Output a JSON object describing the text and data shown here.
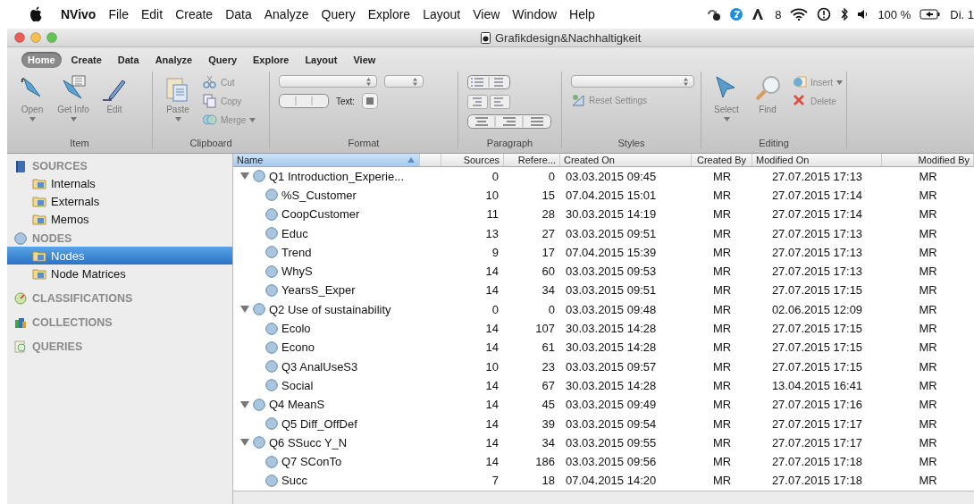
{
  "menu_bar": {
    "app": "NVivo",
    "items": [
      "File",
      "Edit",
      "Create",
      "Data",
      "Analyze",
      "Query",
      "Explore",
      "Layout",
      "View",
      "Window",
      "Help"
    ],
    "badge": "8",
    "battery": "100 %",
    "clock": "Di. 1"
  },
  "window": {
    "title": "Grafikdesign&Nachhaltigkeit"
  },
  "ribbon": {
    "tabs": [
      {
        "label": "Home",
        "selected": true
      },
      {
        "label": "Create",
        "selected": false
      },
      {
        "label": "Data",
        "selected": false
      },
      {
        "label": "Analyze",
        "selected": false
      },
      {
        "label": "Query",
        "selected": false
      },
      {
        "label": "Explore",
        "selected": false
      },
      {
        "label": "Layout",
        "selected": false
      },
      {
        "label": "View",
        "selected": false
      }
    ],
    "groups": [
      {
        "kind": "item",
        "label": "Item",
        "large": [
          {
            "label": "Open",
            "menu": true
          },
          {
            "label": "Get Info",
            "menu": true
          },
          {
            "label": "Edit",
            "menu": false
          }
        ]
      },
      {
        "kind": "clipboard",
        "label": "Clipboard",
        "large": [
          {
            "label": "Paste",
            "menu": true
          }
        ],
        "small": [
          {
            "label": "Cut",
            "menu": false
          },
          {
            "label": "Copy",
            "menu": false
          },
          {
            "label": "Merge",
            "menu": true
          }
        ]
      },
      {
        "kind": "format",
        "label": "Format",
        "text_label": "Text:"
      },
      {
        "kind": "paragraph",
        "label": "Paragraph"
      },
      {
        "kind": "styles",
        "label": "Styles",
        "small": [
          {
            "label": "Reset Settings",
            "menu": false
          }
        ]
      },
      {
        "kind": "editing",
        "label": "Editing",
        "large": [
          {
            "label": "Select",
            "menu": true
          },
          {
            "label": "Find",
            "menu": false
          }
        ],
        "small": [
          {
            "label": "Insert",
            "menu": true
          },
          {
            "label": "Delete",
            "menu": false
          }
        ]
      }
    ]
  },
  "sidebar": {
    "sections": [
      {
        "label": "SOURCES",
        "items": [
          {
            "label": "Internals",
            "selected": false
          },
          {
            "label": "Externals",
            "selected": false
          },
          {
            "label": "Memos",
            "selected": false
          }
        ]
      },
      {
        "label": "NODES",
        "items": [
          {
            "label": "Nodes",
            "selected": true
          },
          {
            "label": "Node Matrices",
            "selected": false
          }
        ]
      },
      {
        "label": "CLASSIFICATIONS"
      },
      {
        "label": "COLLECTIONS"
      },
      {
        "label": "QUERIES"
      }
    ]
  },
  "table": {
    "columns": [
      {
        "label": "Name",
        "sorted": true
      },
      {
        "label": "Sources",
        "sorted": false
      },
      {
        "label": "Refere...",
        "sorted": false
      },
      {
        "label": "Created On",
        "sorted": false
      },
      {
        "label": "Created By",
        "sorted": false
      },
      {
        "label": "Modified On",
        "sorted": false
      },
      {
        "label": "Modified By",
        "sorted": false
      }
    ],
    "rows": [
      {
        "expanded": true,
        "cells": [
          "Q1 Introduction_Experie...",
          "0",
          "0",
          "03.03.2015 09:45",
          "MR",
          "27.07.2015 17:13",
          "MR"
        ],
        "children": [
          {
            "cells": [
              "%S_Customer",
              "10",
              "15",
              "07.04.2015 15:01",
              "MR",
              "27.07.2015 17:14",
              "MR"
            ]
          },
          {
            "cells": [
              "CoopCustomer",
              "11",
              "28",
              "30.03.2015 14:19",
              "MR",
              "27.07.2015 17:14",
              "MR"
            ]
          },
          {
            "cells": [
              "Educ",
              "13",
              "27",
              "03.03.2015 09:51",
              "MR",
              "27.07.2015 17:13",
              "MR"
            ]
          },
          {
            "cells": [
              "Trend",
              "9",
              "17",
              "07.04.2015 15:39",
              "MR",
              "27.07.2015 17:13",
              "MR"
            ]
          },
          {
            "cells": [
              "WhyS",
              "14",
              "60",
              "03.03.2015 09:53",
              "MR",
              "27.07.2015 17:13",
              "MR"
            ]
          },
          {
            "cells": [
              "YearsS_Exper",
              "14",
              "34",
              "03.03.2015 09:51",
              "MR",
              "27.07.2015 17:15",
              "MR"
            ]
          }
        ]
      },
      {
        "expanded": true,
        "cells": [
          "Q2 Use of sustainability",
          "0",
          "0",
          "03.03.2015 09:48",
          "MR",
          "02.06.2015 12:09",
          "MR"
        ],
        "children": [
          {
            "cells": [
              "Ecolo",
              "14",
              "107",
              "30.03.2015 14:28",
              "MR",
              "27.07.2015 17:15",
              "MR"
            ]
          },
          {
            "cells": [
              "Econo",
              "14",
              "61",
              "30.03.2015 14:28",
              "MR",
              "27.07.2015 17:15",
              "MR"
            ]
          },
          {
            "cells": [
              "Q3 AnalUseS3",
              "10",
              "23",
              "03.03.2015 09:57",
              "MR",
              "27.07.2015 17:15",
              "MR"
            ]
          },
          {
            "cells": [
              "Social",
              "14",
              "67",
              "30.03.2015 14:28",
              "MR",
              "13.04.2015 16:41",
              "MR"
            ]
          }
        ]
      },
      {
        "expanded": true,
        "cells": [
          "Q4 MeanS",
          "14",
          "45",
          "03.03.2015 09:49",
          "MR",
          "27.07.2015 17:16",
          "MR"
        ],
        "children": [
          {
            "cells": [
              "Q5 Diff_OffDef",
              "14",
              "39",
              "03.03.2015 09:54",
              "MR",
              "27.07.2015 17:17",
              "MR"
            ]
          }
        ]
      },
      {
        "expanded": true,
        "cells": [
          "Q6 SSucc Y_N",
          "14",
          "34",
          "03.03.2015 09:55",
          "MR",
          "27.07.2015 17:17",
          "MR"
        ],
        "children": [
          {
            "cells": [
              "Q7 SConTo",
              "14",
              "186",
              "03.03.2015 09:56",
              "MR",
              "27.07.2015 17:18",
              "MR"
            ]
          },
          {
            "cells": [
              "Succ",
              "7",
              "18",
              "07.04.2015 14:20",
              "MR",
              "27.07.2015 17:18",
              "MR"
            ]
          }
        ]
      }
    ]
  }
}
